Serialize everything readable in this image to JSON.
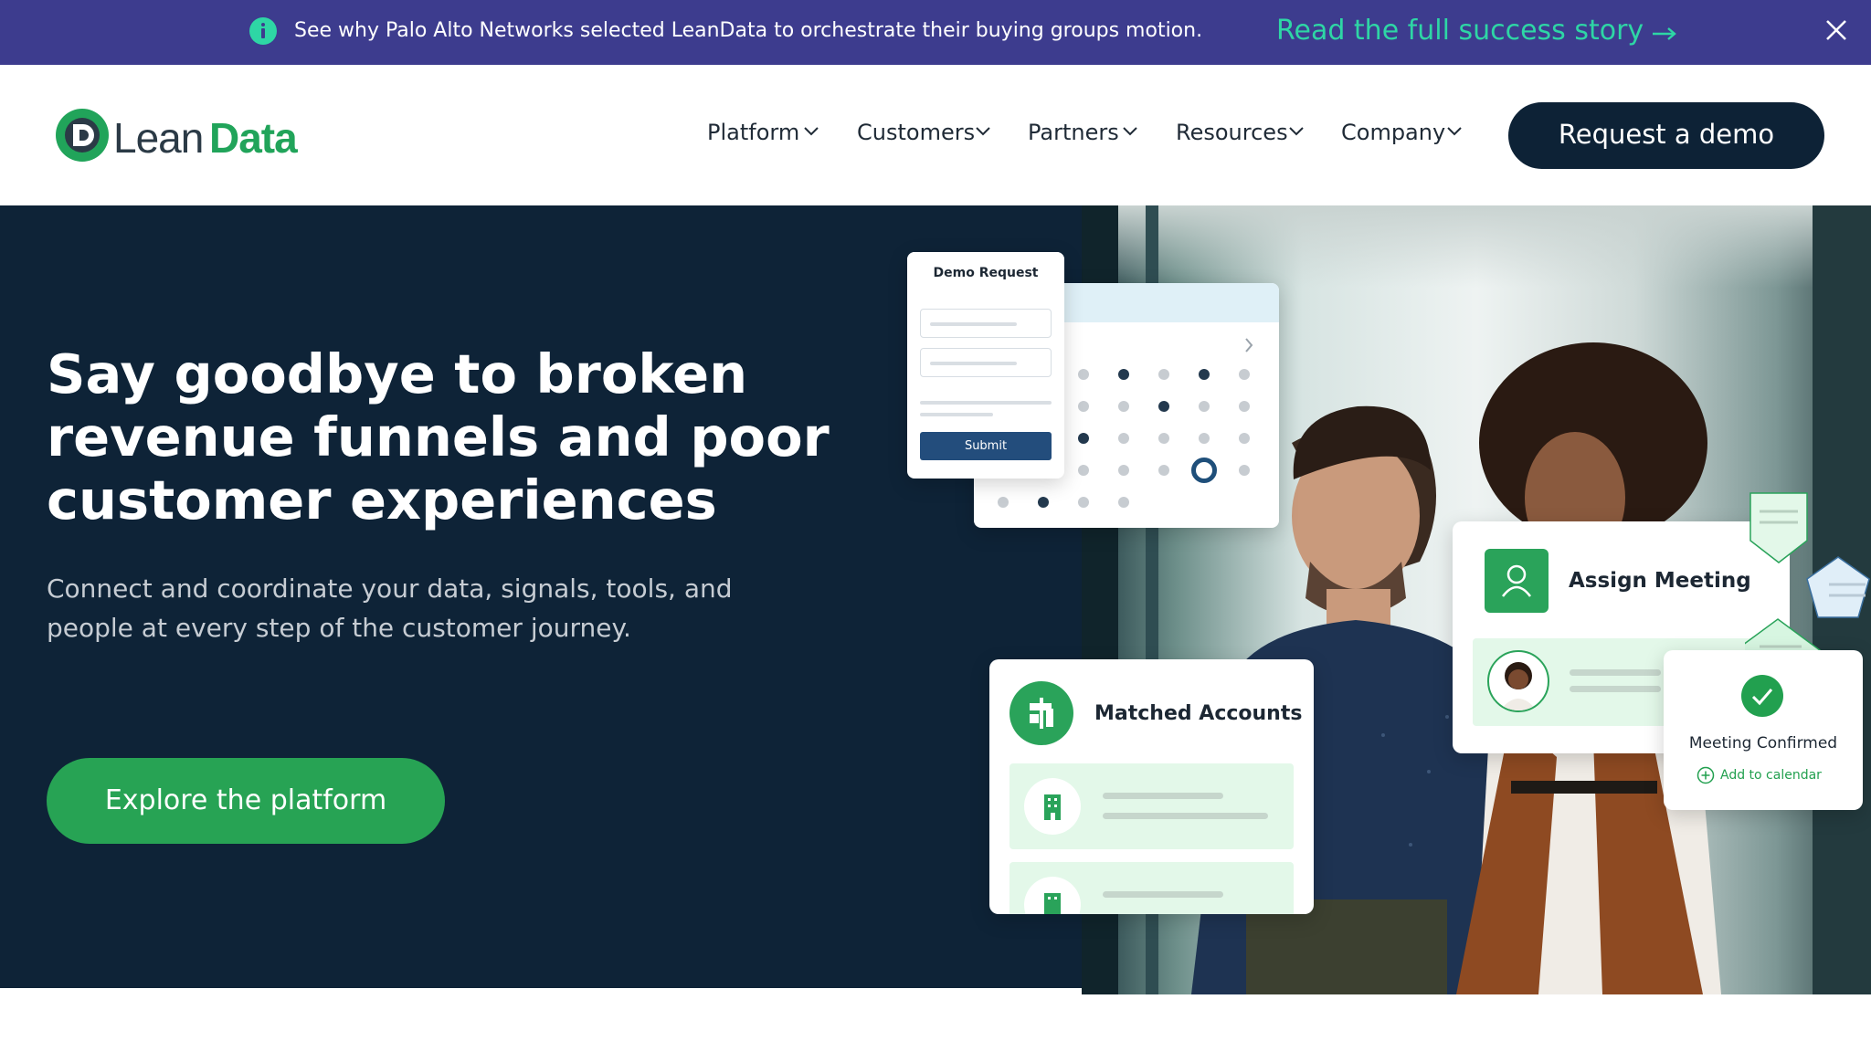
{
  "announcement": {
    "icon": "info-icon",
    "message": "See why Palo Alto Networks selected LeanData to orchestrate their buying groups motion.",
    "link_label": "Read the full success story",
    "link_icon": "arrow-right-icon",
    "close_icon": "close-icon",
    "background": "#3d3c8e",
    "accent": "#2ed6a5"
  },
  "header": {
    "logo": {
      "lean": "Lean",
      "data": "Data"
    },
    "nav": [
      {
        "label": "Platform"
      },
      {
        "label": "Customers"
      },
      {
        "label": "Partners"
      },
      {
        "label": "Resources"
      },
      {
        "label": "Company"
      }
    ],
    "cta_label": "Request a demo",
    "cta_color": "#0d2236"
  },
  "hero": {
    "headline": "Say goodbye to broken revenue funnels and poor customer experiences",
    "subtext": "Connect and coordinate your data, signals, tools, and people at every step of the customer journey.",
    "cta_label": "Explore the platform",
    "cta_color": "#27a354",
    "background": "#0e2337"
  },
  "illustration": {
    "demo_request": {
      "title": "Demo Request",
      "submit_label": "Submit"
    },
    "matched_accounts": {
      "title": "Matched Accounts",
      "icon": "signpost-icon",
      "row_icon": "building-icon"
    },
    "assign_meeting": {
      "title": "Assign Meeting",
      "icon": "user-icon"
    },
    "meeting_confirmed": {
      "title": "Meeting Confirmed",
      "add_label": "Add to calendar",
      "icon": "check-icon",
      "add_icon": "plus-circle-icon"
    }
  }
}
